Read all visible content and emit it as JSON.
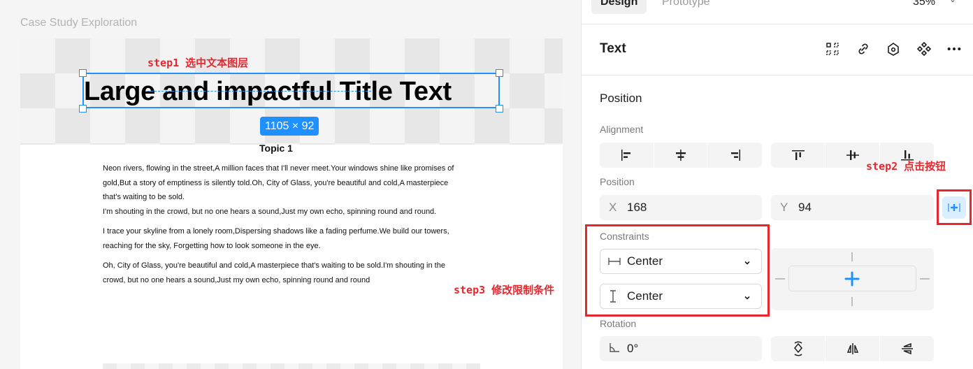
{
  "canvas": {
    "frame_label": "Case Study Exploration",
    "title_text": "Large and impactful Title Text",
    "dimensions_badge": "1105 × 92",
    "topic_heading": "Topic 1",
    "paragraphs": [
      [
        "Neon rivers, flowing in the street,A million faces that I'll never meet.Your windows shine like promises of",
        "gold,But a story of emptiness is silently told.Oh, City of Glass, you're beautiful and cold,A masterpiece",
        "that's waiting to be sold.",
        "I'm shouting in the crowd, but no one hears a sound,Just my own echo, spinning round and round."
      ],
      [
        "I trace your skyline from a lonely room,Dispersing shadows like a fading perfume.We build our towers,",
        "reaching for the sky, Forgetting how to look someone in the eye."
      ],
      [
        "Oh, City of Glass, you're beautiful and cold,A masterpiece that's waiting to be sold.I'm shouting in the",
        "crowd, but no one hears a sound,Just my own echo, spinning round and round"
      ]
    ]
  },
  "annotations": {
    "step1": "step1 选中文本图层",
    "step2": "step2 点击按钮",
    "step3": "step3 修改限制条件",
    "color": "#e8262d"
  },
  "panel": {
    "tabs": [
      {
        "label": "Design",
        "active": true
      },
      {
        "label": "Prototype",
        "active": false
      }
    ],
    "zoom": "35%",
    "header": {
      "title": "Text",
      "icons": [
        "grid-select-icon",
        "link-icon",
        "target-icon",
        "component-icon",
        "more-icon"
      ]
    },
    "position_section": {
      "title": "Position",
      "alignment_label": "Alignment",
      "position_label": "Position",
      "x_prefix": "X",
      "x_value": "168",
      "y_prefix": "Y",
      "y_value": "94"
    },
    "constraints": {
      "label": "Constraints",
      "horizontal": "Center",
      "vertical": "Center"
    },
    "rotation": {
      "label": "Rotation",
      "value": "0°"
    },
    "accent_color": "#1e90ff"
  }
}
